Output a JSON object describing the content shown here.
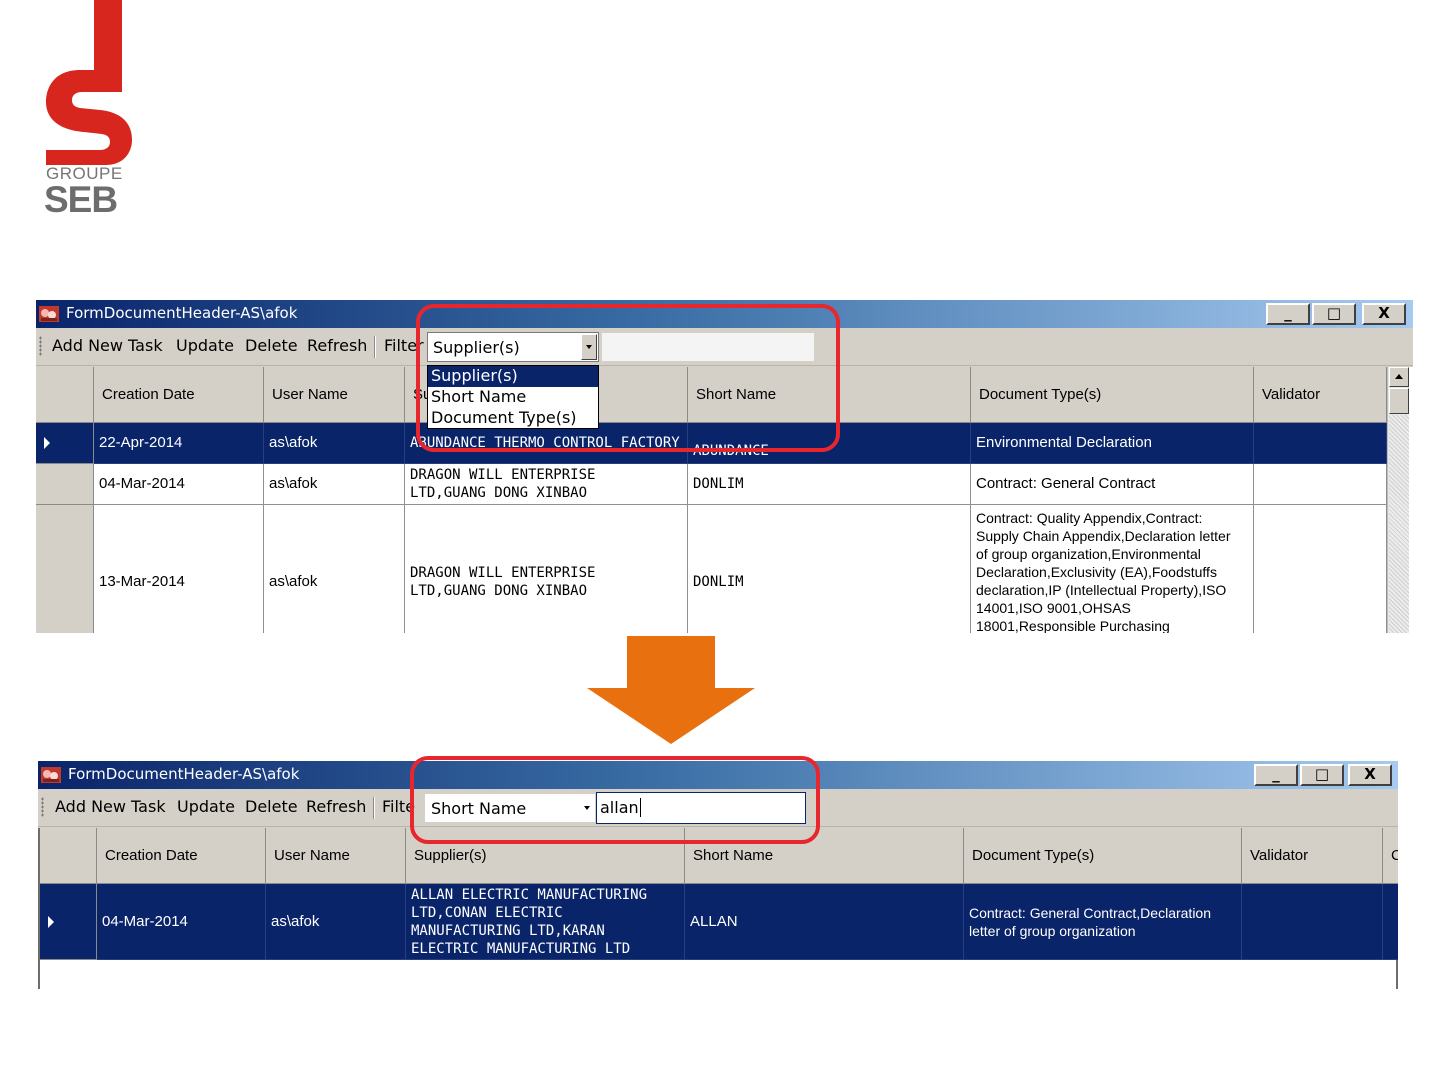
{
  "logo": {
    "line1": "GROUPE",
    "line2": "SEB",
    "brand_red": "#d6261d",
    "brand_gray": "#6d6d6d"
  },
  "arrow_color": "#e8700f",
  "highlight_color": "#e8262e",
  "before": {
    "title": "FormDocumentHeader-AS\\afok",
    "window_buttons": {
      "minimize": "_",
      "maximize": "□",
      "close": "X"
    },
    "toolbar": {
      "add": "Add New Task",
      "update": "Update",
      "delete": "Delete",
      "refresh": "Refresh",
      "filter": "Filter",
      "filter_field": "Supplier(s)",
      "filter_value": ""
    },
    "dropdown_options": [
      "Supplier(s)",
      "Short Name",
      "Document Type(s)"
    ],
    "columns": [
      "Creation Date",
      "User Name",
      "Supplier(s)",
      "Short Name",
      "Document Type(s)",
      "Validator"
    ],
    "rows": [
      {
        "date": "22-Apr-2014",
        "user": "as\\afok",
        "supplier": "ABUNDANCE THERMO CONTROL FACTORY",
        "short": "ABUNDANCE",
        "doctype": "Environmental Declaration",
        "validator": ""
      },
      {
        "date": "04-Mar-2014",
        "user": "as\\afok",
        "supplier": "DRAGON WILL ENTERPRISE\nLTD,GUANG DONG XINBAO",
        "short": "DONLIM",
        "doctype": "Contract: General Contract",
        "validator": ""
      },
      {
        "date": "13-Mar-2014",
        "user": "as\\afok",
        "supplier": "DRAGON WILL ENTERPRISE\nLTD,GUANG DONG XINBAO",
        "short": "DONLIM",
        "doctype": "Contract: Quality Appendix,Contract:\nSupply Chain Appendix,Declaration letter\nof group organization,Environmental\nDeclaration,Exclusivity (EA),Foodstuffs\ndeclaration,IP (Intellectual Property),ISO\n14001,ISO 9001,OHSAS\n18001,Responsible Purchasing",
        "validator": ""
      }
    ]
  },
  "after": {
    "title": "FormDocumentHeader-AS\\afok",
    "window_buttons": {
      "minimize": "_",
      "maximize": "□",
      "close": "X"
    },
    "toolbar": {
      "add": "Add New Task",
      "update": "Update",
      "delete": "Delete",
      "refresh": "Refresh",
      "filter": "Filte",
      "filter_field": "Short Name",
      "filter_value": "allan"
    },
    "columns": [
      "Creation Date",
      "User Name",
      "Supplier(s)",
      "Short Name",
      "Document Type(s)",
      "Validator",
      "C"
    ],
    "rows": [
      {
        "date": "04-Mar-2014",
        "user": "as\\afok",
        "supplier": "ALLAN ELECTRIC MANUFACTURING\nLTD,CONAN ELECTRIC\nMANUFACTURING LTD,KARAN\nELECTRIC MANUFACTURING LTD",
        "short": "ALLAN",
        "doctype": "Contract: General Contract,Declaration\nletter of group organization",
        "validator": ""
      }
    ]
  }
}
